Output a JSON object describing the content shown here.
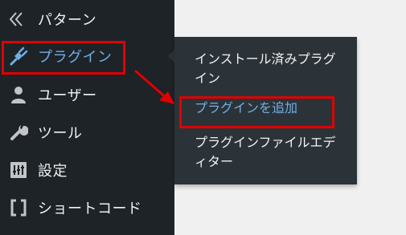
{
  "sidebar": {
    "items": [
      {
        "label": "パターン",
        "icon": "pattern-icon"
      },
      {
        "label": "プラグイン",
        "icon": "plugin-icon",
        "active": true
      },
      {
        "label": "ユーザー",
        "icon": "user-icon"
      },
      {
        "label": "ツール",
        "icon": "wrench-icon"
      },
      {
        "label": "設定",
        "icon": "settings-icon"
      },
      {
        "label": "ショートコード",
        "icon": "brackets-icon"
      }
    ]
  },
  "submenu": {
    "items": [
      {
        "label": "インストール済みプラグイン"
      },
      {
        "label": "プラグインを追加",
        "current": true
      },
      {
        "label": "プラグインファイルエディター"
      }
    ]
  },
  "colors": {
    "sidebar_bg": "#1d2327",
    "submenu_bg": "#2c3338",
    "text": "#f0f0f1",
    "accent": "#72aee6",
    "highlight": "#e10000",
    "page_bg": "#f0f0f1"
  }
}
